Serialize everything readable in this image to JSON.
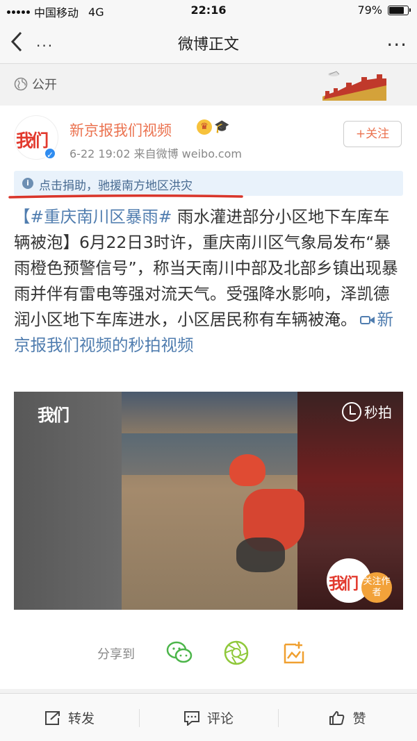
{
  "status_bar": {
    "carrier": "中国移动",
    "network": "4G",
    "time": "22:16",
    "battery_percent": "79%",
    "battery_level": 0.79
  },
  "nav": {
    "title": "微博正文",
    "back_dots": "...",
    "more_dots": "..."
  },
  "visibility": {
    "label": "公开"
  },
  "post": {
    "author": "新京报我们视频",
    "avatar_text": "我们",
    "meta": "6-22 19:02  来自微博 weibo.com",
    "follow_label": "+关注",
    "donate_text": "点击捐助，驰援南方地区洪灾",
    "hashtag": "【#重庆南川区暴雨#",
    "body": " 雨水灌进部分小区地下车库车辆被泡】6月22日3时许，重庆南川区气象局发布“暴雨橙色预警信号”，称当天南川中部及北部乡镇出现暴雨并伴有雷电等强对流天气。受强降水影响，泽凯德润小区地下车库进水，小区居民称有车辆被淹。",
    "video_link": "新京报我们视频的秒拍视频"
  },
  "video": {
    "logo": "我们",
    "miaopai_label": "秒拍",
    "author_badge": "我们",
    "follow_author": "关注作者"
  },
  "share": {
    "label": "分享到",
    "icons": [
      "wechat-icon",
      "moments-icon",
      "album-icon"
    ]
  },
  "actions": {
    "repost": "转发",
    "comment": "评论",
    "like": "赞"
  },
  "colors": {
    "accent": "#eb7350",
    "link": "#507daf",
    "donate_bg": "#e9f2fb"
  }
}
